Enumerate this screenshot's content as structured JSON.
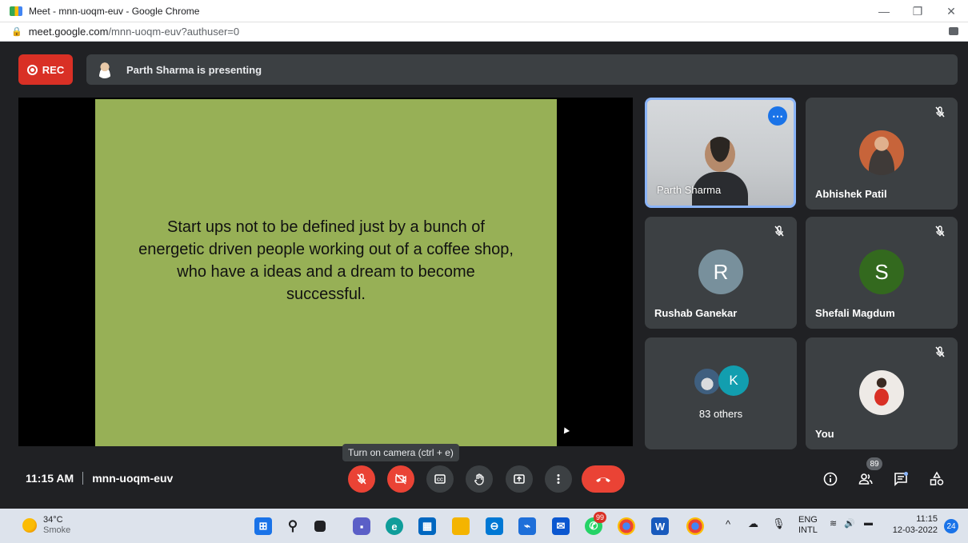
{
  "browser": {
    "window_title": "Meet - mnn-uoqm-euv - Google Chrome",
    "url_host": "meet.google.com",
    "url_path": "/mnn-uoqm-euv?authuser=0"
  },
  "meet": {
    "rec_label": "REC",
    "presenting_text": "Parth Sharma is presenting",
    "slide_text": "Start ups not to be defined just by a bunch of energetic driven people working out of a coffee shop, who have a ideas and a dream to become successful.",
    "tiles": [
      {
        "name": "Parth Sharma",
        "type": "video"
      },
      {
        "name": "Abhishek Patil",
        "type": "photo",
        "muted": true
      },
      {
        "name": "Rushab Ganekar",
        "type": "letter",
        "letter": "R",
        "color": "#78909c",
        "muted": true
      },
      {
        "name": "Shefali Magdum",
        "type": "letter",
        "letter": "S",
        "color": "#33691e",
        "muted": true
      },
      {
        "others_label": "83 others",
        "others_letter": "K"
      },
      {
        "name": "You",
        "type": "photo",
        "muted": true
      }
    ],
    "tooltip": "Turn on camera (ctrl + e)",
    "time": "11:15 AM",
    "meeting_code": "mnn-uoqm-euv",
    "participants_count": "89"
  },
  "taskbar": {
    "temperature": "34°C",
    "condition": "Smoke",
    "whatsapp_badge": "99",
    "lang_top": "ENG",
    "lang_bottom": "INTL",
    "clock_time": "11:15",
    "clock_date": "12-03-2022",
    "notification_count": "24"
  },
  "colors": {
    "meet_bg": "#202124",
    "tile_bg": "#3c4043",
    "slide_bg": "#97b056",
    "danger": "#ea4335",
    "accent": "#8ab4f8"
  }
}
